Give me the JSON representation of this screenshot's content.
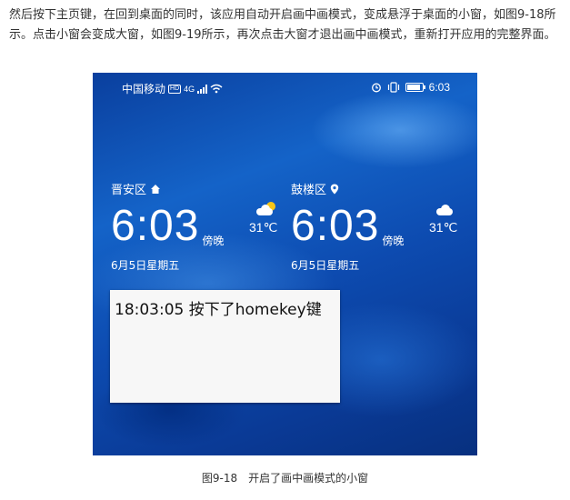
{
  "article": {
    "intro": "然后按下主页键，在回到桌面的同时，该应用自动开启画中画模式，变成悬浮于桌面的小窗，如图9-18所示。点击小窗会变成大窗，如图9-19所示，再次点击大窗才退出画中画模式，重新打开应用的完整界面。",
    "caption": "图9-18　开启了画中画模式的小窗"
  },
  "phone": {
    "status": {
      "carrier": "中国移动",
      "hd": "HD",
      "network": "4G",
      "time": "6:03"
    },
    "clocks": [
      {
        "location": "晋安区",
        "location_icon": "home-icon",
        "time": "6:03",
        "period": "傍晚",
        "date": "6月5日星期五",
        "temperature": "31℃",
        "weather_icon": "sun-cloud-icon"
      },
      {
        "location": "鼓楼区",
        "location_icon": "location-pin-icon",
        "time": "6:03",
        "period": "傍晚",
        "date": "6月5日星期五",
        "temperature": "31℃",
        "weather_icon": "cloud-icon"
      }
    ],
    "pip_window": {
      "text": "18:03:05 按下了homekey键"
    }
  }
}
